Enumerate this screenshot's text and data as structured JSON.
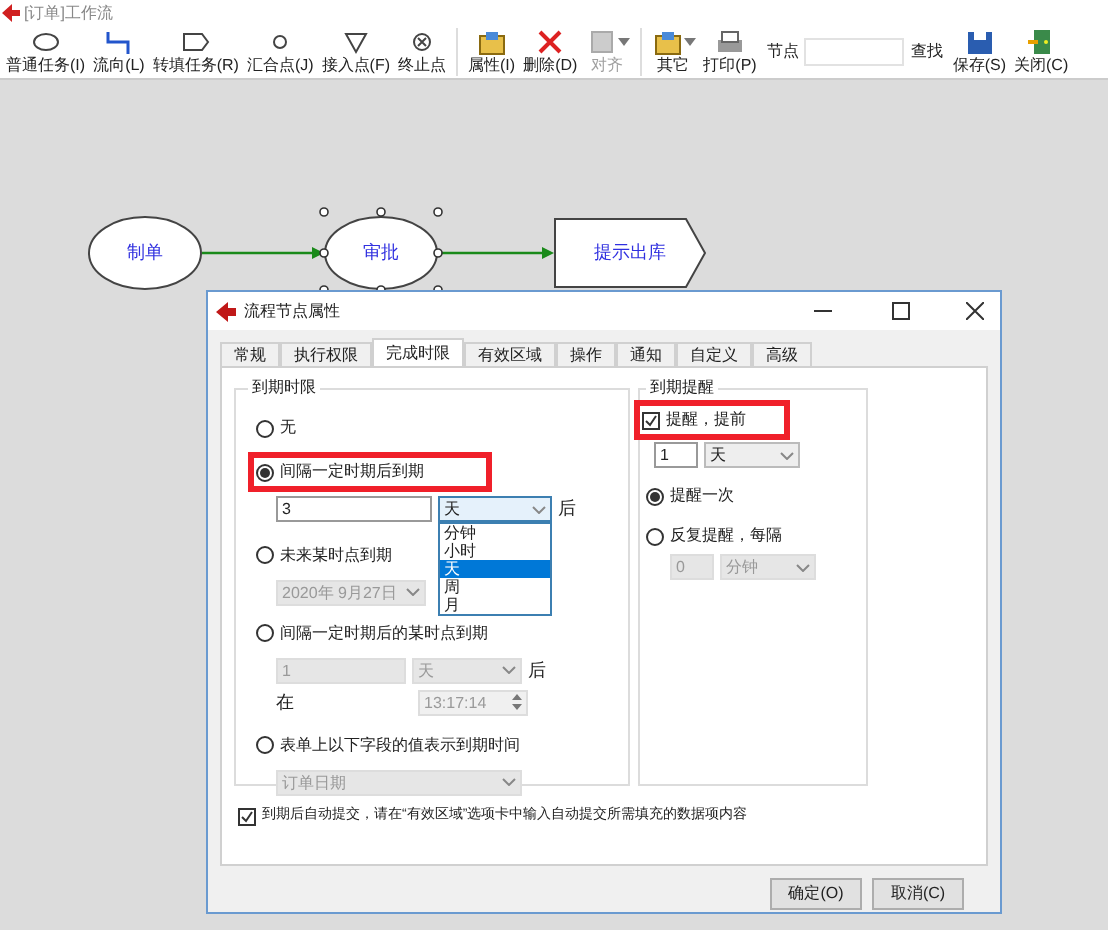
{
  "window": {
    "title": "[订单]工作流"
  },
  "toolbar": {
    "groups": [
      [
        {
          "label": "普通任务(I)",
          "kind": "ellipse",
          "disabled": false,
          "menu": false
        },
        {
          "label": "流向(L)",
          "kind": "connector",
          "disabled": false,
          "menu": false
        },
        {
          "label": "转填任务(R)",
          "kind": "tag",
          "disabled": false,
          "menu": false
        },
        {
          "label": "汇合点(J)",
          "kind": "circle",
          "disabled": false,
          "menu": false
        },
        {
          "label": "接入点(F)",
          "kind": "triangle",
          "disabled": false,
          "menu": false
        },
        {
          "label": "终止点",
          "kind": "stop",
          "disabled": false,
          "menu": false
        }
      ],
      [
        {
          "label": "属性(I)",
          "kind": "props",
          "disabled": false,
          "menu": false
        },
        {
          "label": "删除(D)",
          "kind": "delete",
          "disabled": false,
          "menu": false
        },
        {
          "label": "对齐",
          "kind": "align",
          "disabled": true,
          "menu": true
        }
      ],
      [
        {
          "label": "其它",
          "kind": "props",
          "disabled": false,
          "menu": true
        },
        {
          "label": "打印(P)",
          "kind": "print",
          "disabled": false,
          "menu": false
        }
      ]
    ],
    "search": {
      "label": "节点",
      "button": "查找"
    },
    "end": [
      {
        "label": "保存(S)",
        "kind": "save",
        "disabled": false,
        "menu": false
      },
      {
        "label": "关闭(C)",
        "kind": "exit",
        "disabled": false,
        "menu": false
      }
    ]
  },
  "diagram": {
    "nodes": [
      {
        "label": "制单",
        "kind": "ellipse",
        "selected": false
      },
      {
        "label": "审批",
        "kind": "ellipse",
        "selected": true
      },
      {
        "label": "提示出库",
        "kind": "pentagon",
        "selected": false
      }
    ]
  },
  "dialog": {
    "title": "流程节点属性",
    "tabs": [
      {
        "label": "常规",
        "selected": false
      },
      {
        "label": "执行权限",
        "selected": false
      },
      {
        "label": "完成时限",
        "selected": true
      },
      {
        "label": "有效区域",
        "selected": false
      },
      {
        "label": "操作",
        "selected": false
      },
      {
        "label": "通知",
        "selected": false
      },
      {
        "label": "自定义",
        "selected": false
      },
      {
        "label": "高级",
        "selected": false
      }
    ],
    "deadline": {
      "title": "到期时限",
      "options": [
        {
          "kind": "none",
          "label": "无",
          "selected": false,
          "highlighted": false
        },
        {
          "kind": "interval",
          "label": "间隔一定时期后到期",
          "selected": true,
          "highlighted": true,
          "amount": "3",
          "unit": "天",
          "suffix": "后",
          "unit_list": {
            "expanded": true,
            "items": [
              {
                "label": "分钟",
                "selected": false
              },
              {
                "label": "小时",
                "selected": false
              },
              {
                "label": "天",
                "selected": true
              },
              {
                "label": "周",
                "selected": false
              },
              {
                "label": "月",
                "selected": false
              }
            ]
          }
        },
        {
          "kind": "date",
          "label": "未来某时点到期",
          "selected": false,
          "highlighted": false,
          "date": "2020年 9月27日"
        },
        {
          "kind": "interval_time",
          "label": "间隔一定时期后的某时点到期",
          "selected": false,
          "highlighted": false,
          "amount": "1",
          "unit": "天",
          "suffix": "后",
          "at_label": "在",
          "time": "13:17:14"
        },
        {
          "kind": "field",
          "label": "表单上以下字段的值表示到期时间",
          "selected": false,
          "highlighted": false,
          "field": "订单日期"
        }
      ]
    },
    "reminder": {
      "title": "到期提醒",
      "advance": {
        "label": "提醒，提前",
        "checked": true,
        "highlighted": true,
        "amount": "1",
        "unit": "天"
      },
      "modes": [
        {
          "label": "提醒一次",
          "selected": true
        },
        {
          "label": "反复提醒，每隔",
          "selected": false,
          "amount": "0",
          "unit": "分钟"
        }
      ]
    },
    "auto_submit": {
      "label": "到期后自动提交，请在“有效区域”选项卡中输入自动提交所需填充的数据项内容",
      "checked": true
    },
    "buttons": [
      "确定(O)",
      "取消(C)"
    ]
  }
}
